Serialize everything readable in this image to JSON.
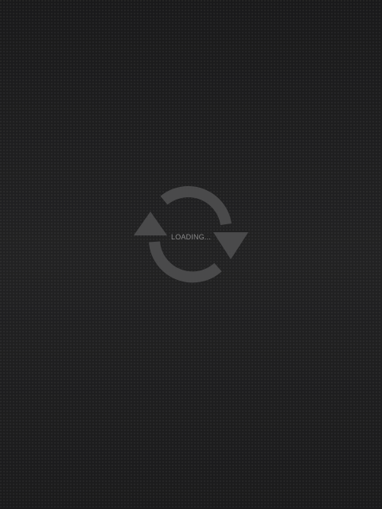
{
  "loader": {
    "label": "LOADING...",
    "icon": "refresh-cycle-icon",
    "icon_color": "#4a4a4b"
  },
  "colors": {
    "background": "#1e1e1f",
    "text": "#8a8a8a"
  }
}
